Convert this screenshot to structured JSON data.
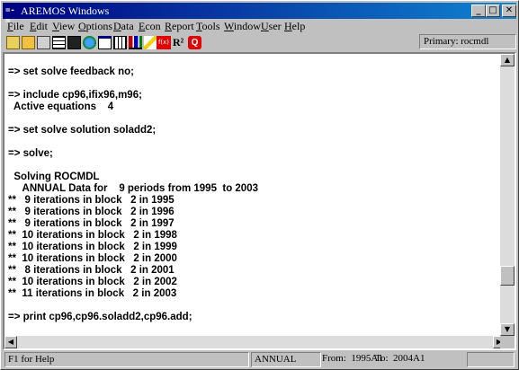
{
  "window": {
    "title": "AREMOS Windows",
    "app_icon": "=-=",
    "minimize": "_",
    "maximize": "□",
    "close": "✕"
  },
  "menu": {
    "items": [
      {
        "ul": "F",
        "rest": "ile"
      },
      {
        "ul": "E",
        "rest": "dit"
      },
      {
        "ul": "V",
        "rest": "iew"
      },
      {
        "ul": "O",
        "rest": "ptions"
      },
      {
        "ul": "D",
        "rest": "ata"
      },
      {
        "ul": "E",
        "rest": "con"
      },
      {
        "ul": "R",
        "rest": "eport"
      },
      {
        "ul": "T",
        "rest": "ools"
      },
      {
        "ul": "W",
        "rest": "indow"
      },
      {
        "ul": "U",
        "rest": "ser"
      },
      {
        "ul": "H",
        "rest": "elp"
      }
    ]
  },
  "toolbar": {
    "icons": [
      "open-folder-icon",
      "folder-icon",
      "edit-icon",
      "grid-icon",
      "save-icon",
      "globe-icon",
      "chart-window-icon",
      "table-icon",
      "bar-chart-icon",
      "pencil-icon",
      "stats-icon",
      "r-squared-icon",
      "quit-icon"
    ],
    "stats_label": "f(x)",
    "r2_label": "R²",
    "quit_label": "Q",
    "primary": "Primary: rocmdl"
  },
  "console": {
    "lines": [
      "=> set solve feedback no;",
      "",
      "=> include cp96,ifix96,m96;",
      "  Active equations    4",
      "",
      "=> set solve solution soladd2;",
      "",
      "=> solve;",
      "",
      "  Solving ROCMDL",
      "     ANNUAL Data for    9 periods from 1995  to 2003",
      "**   9 iterations in block   2 in 1995",
      "**   9 iterations in block   2 in 1996",
      "**   9 iterations in block   2 in 1997",
      "**  10 iterations in block   2 in 1998",
      "**  10 iterations in block   2 in 1999",
      "**  10 iterations in block   2 in 2000",
      "**   8 iterations in block   2 in 2001",
      "**  10 iterations in block   2 in 2002",
      "**  11 iterations in block   2 in 2003",
      "",
      "=> print cp96,cp96.soladd2,cp96.add;"
    ]
  },
  "status": {
    "help": "F1 for Help",
    "frequency": "ANNUAL",
    "from": "From:  1995A1",
    "to": "To:  2004A1"
  }
}
